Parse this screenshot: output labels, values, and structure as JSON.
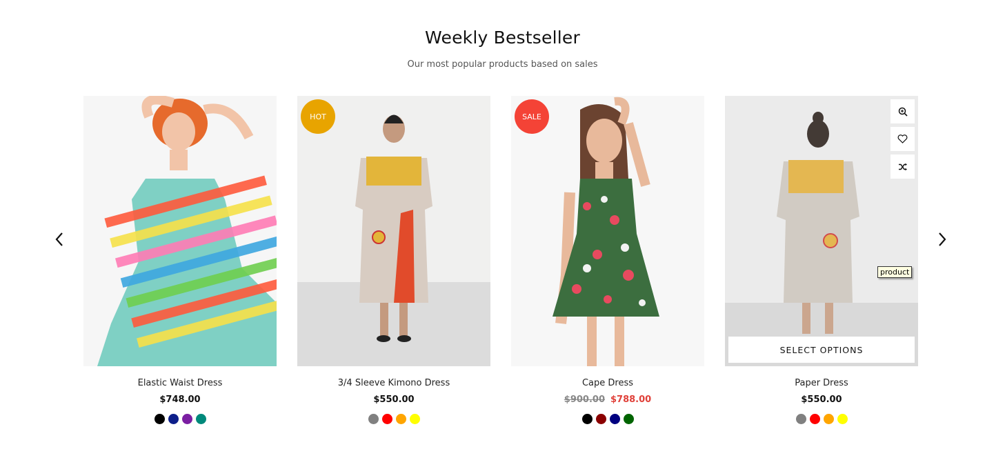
{
  "section": {
    "title": "Weekly Bestseller",
    "subtitle": "Our most popular products based on sales"
  },
  "products": [
    {
      "name": "Elastic Waist Dress",
      "price": "$748.00",
      "badge": null,
      "swatches": [
        "#000000",
        "#0d1f8a",
        "#7b1fa2",
        "#00897b"
      ]
    },
    {
      "name": "3/4 Sleeve Kimono Dress",
      "price": "$550.00",
      "badge": {
        "label": "HOT",
        "color": "#e8a400"
      },
      "swatches": [
        "#808080",
        "#ff0000",
        "#ffa500",
        "#ffff00"
      ]
    },
    {
      "name": "Cape Dress",
      "old_price": "$900.00",
      "sale_price": "$788.00",
      "badge": {
        "label": "SALE",
        "color": "#f44336"
      },
      "swatches": [
        "#000000",
        "#8b0000",
        "#000080",
        "#006400"
      ]
    },
    {
      "name": "Paper Dress",
      "price": "$550.00",
      "badge": null,
      "swatches": [
        "#808080",
        "#ff0000",
        "#ffa500",
        "#ffff00"
      ],
      "hover": {
        "select_options_label": "SELECT OPTIONS",
        "tooltip": "product",
        "actions": [
          "zoom-in-icon",
          "heart-icon",
          "shuffle-icon"
        ]
      }
    }
  ],
  "icons": {
    "prev": "chevron-left-icon",
    "next": "chevron-right-icon"
  }
}
